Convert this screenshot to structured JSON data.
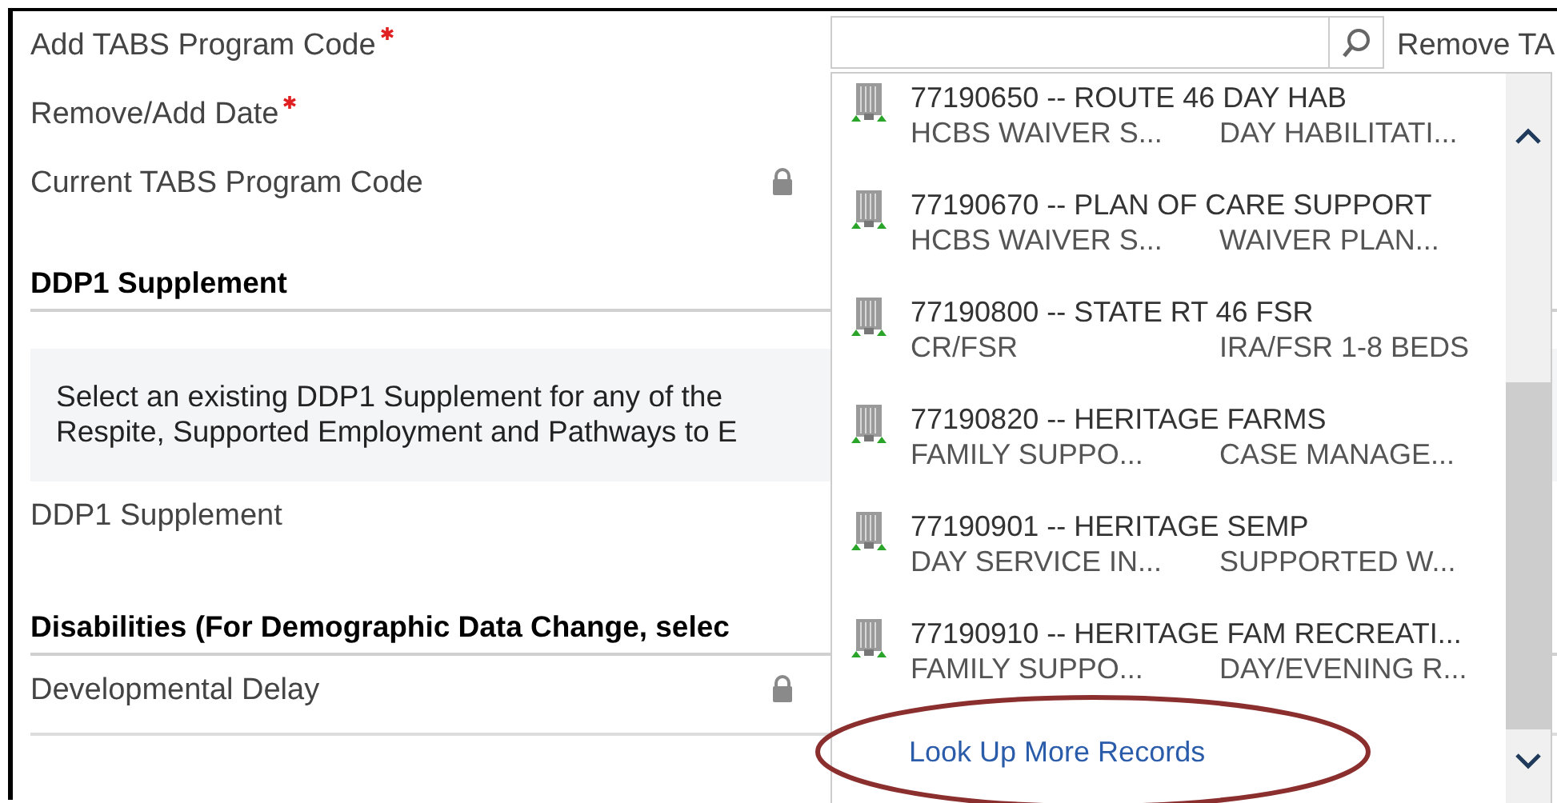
{
  "top_fields": [
    {
      "label": "Add TABS Program Code",
      "required": true,
      "locked": false
    },
    {
      "label": "Remove/Add Date",
      "required": true,
      "locked": false
    },
    {
      "label": "Current TABS Program Code",
      "required": false,
      "locked": true
    }
  ],
  "side_label": "Remove TA",
  "sections": [
    {
      "heading": "DDP1 Supplement",
      "note_lines": [
        "Select an existing DDP1 Supplement for any of the",
        "Respite, Supported Employment and Pathways to E"
      ],
      "fields": [
        {
          "label": "DDP1 Supplement",
          "required": false,
          "locked": false
        }
      ]
    },
    {
      "heading": "Disabilities (For Demographic Data Change, selec",
      "fields": [
        {
          "label": "Developmental Delay",
          "required": false,
          "locked": true
        }
      ]
    }
  ],
  "lookup": {
    "results": [
      {
        "title": "77190650 -- ROUTE 46 DAY HAB",
        "column_1": "HCBS WAIVER S...",
        "column_2": "DAY HABILITATI..."
      },
      {
        "title": "77190670 -- PLAN OF CARE SUPPORT",
        "column_1": "HCBS WAIVER S...",
        "column_2": "WAIVER PLAN..."
      },
      {
        "title": "77190800 -- STATE RT 46 FSR",
        "column_1": "CR/FSR",
        "column_2": "IRA/FSR 1-8 BEDS"
      },
      {
        "title": "77190820 -- HERITAGE FARMS",
        "column_1": "FAMILY SUPPO...",
        "column_2": "CASE MANAGE..."
      },
      {
        "title": "77190901 -- HERITAGE SEMP",
        "column_1": "DAY SERVICE IN...",
        "column_2": "SUPPORTED W..."
      },
      {
        "title": "77190910 -- HERITAGE FAM RECREATI...",
        "column_1": "FAMILY SUPPO...",
        "column_2": "DAY/EVENING R..."
      }
    ],
    "more_link": "Look Up More Records"
  }
}
